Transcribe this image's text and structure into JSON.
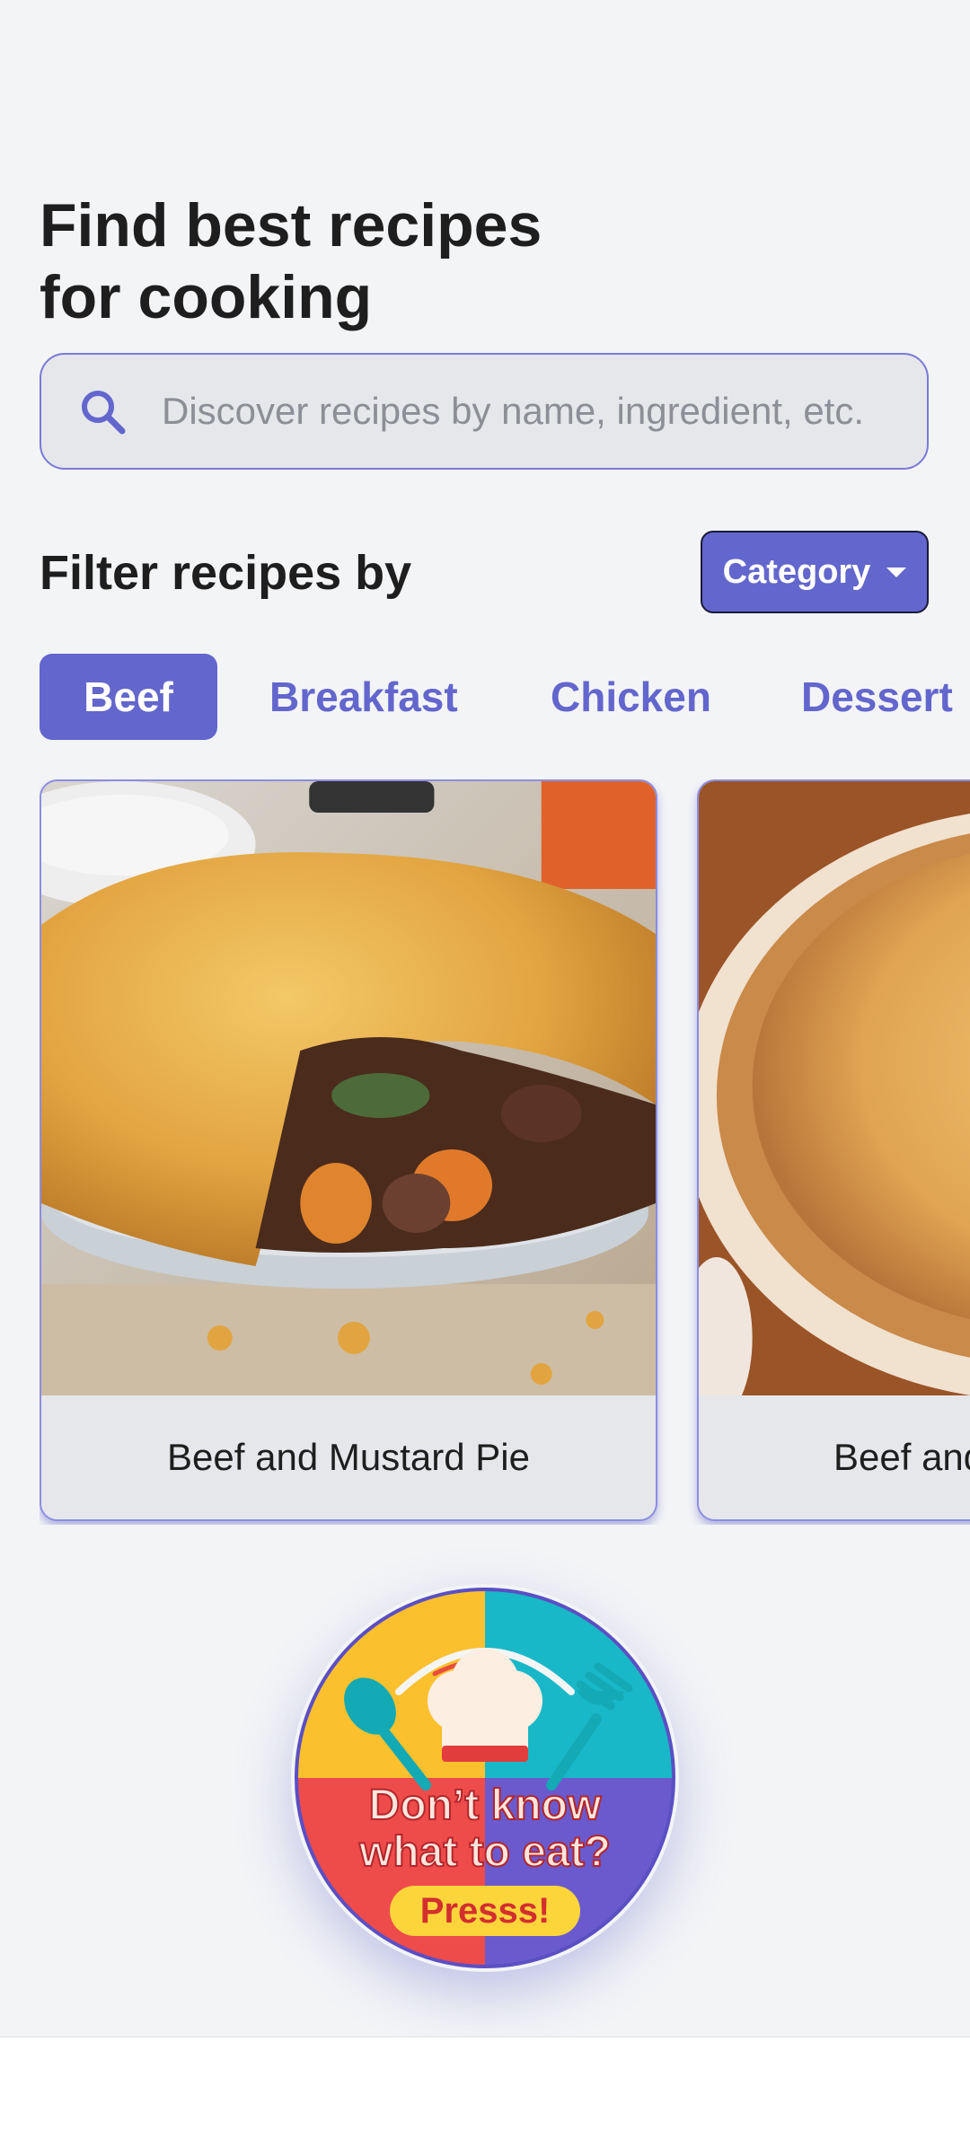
{
  "header": {
    "title_line1": "Find best recipes",
    "title_line2": "for cooking"
  },
  "search": {
    "placeholder": "Discover recipes by name, ingredient, etc.",
    "value": "",
    "icon": "search-icon"
  },
  "filter": {
    "label": "Filter recipes by",
    "dropdown_label": "Category",
    "dropdown_icon": "caret-down-icon"
  },
  "categories": [
    {
      "label": "Beef",
      "active": true
    },
    {
      "label": "Breakfast",
      "active": false
    },
    {
      "label": "Chicken",
      "active": false
    },
    {
      "label": "Dessert",
      "active": false
    }
  ],
  "recipes": [
    {
      "title": "Beef and Mustard Pie"
    },
    {
      "title": "Beef and Oyster pie"
    }
  ],
  "random_button": {
    "line1": "Don’t know",
    "line2": "what to eat?",
    "cta": "Presss!"
  },
  "colors": {
    "accent": "#6366cc",
    "background": "#f3f4f6",
    "surface": "#e5e7eb",
    "text": "#1e1e1e"
  }
}
